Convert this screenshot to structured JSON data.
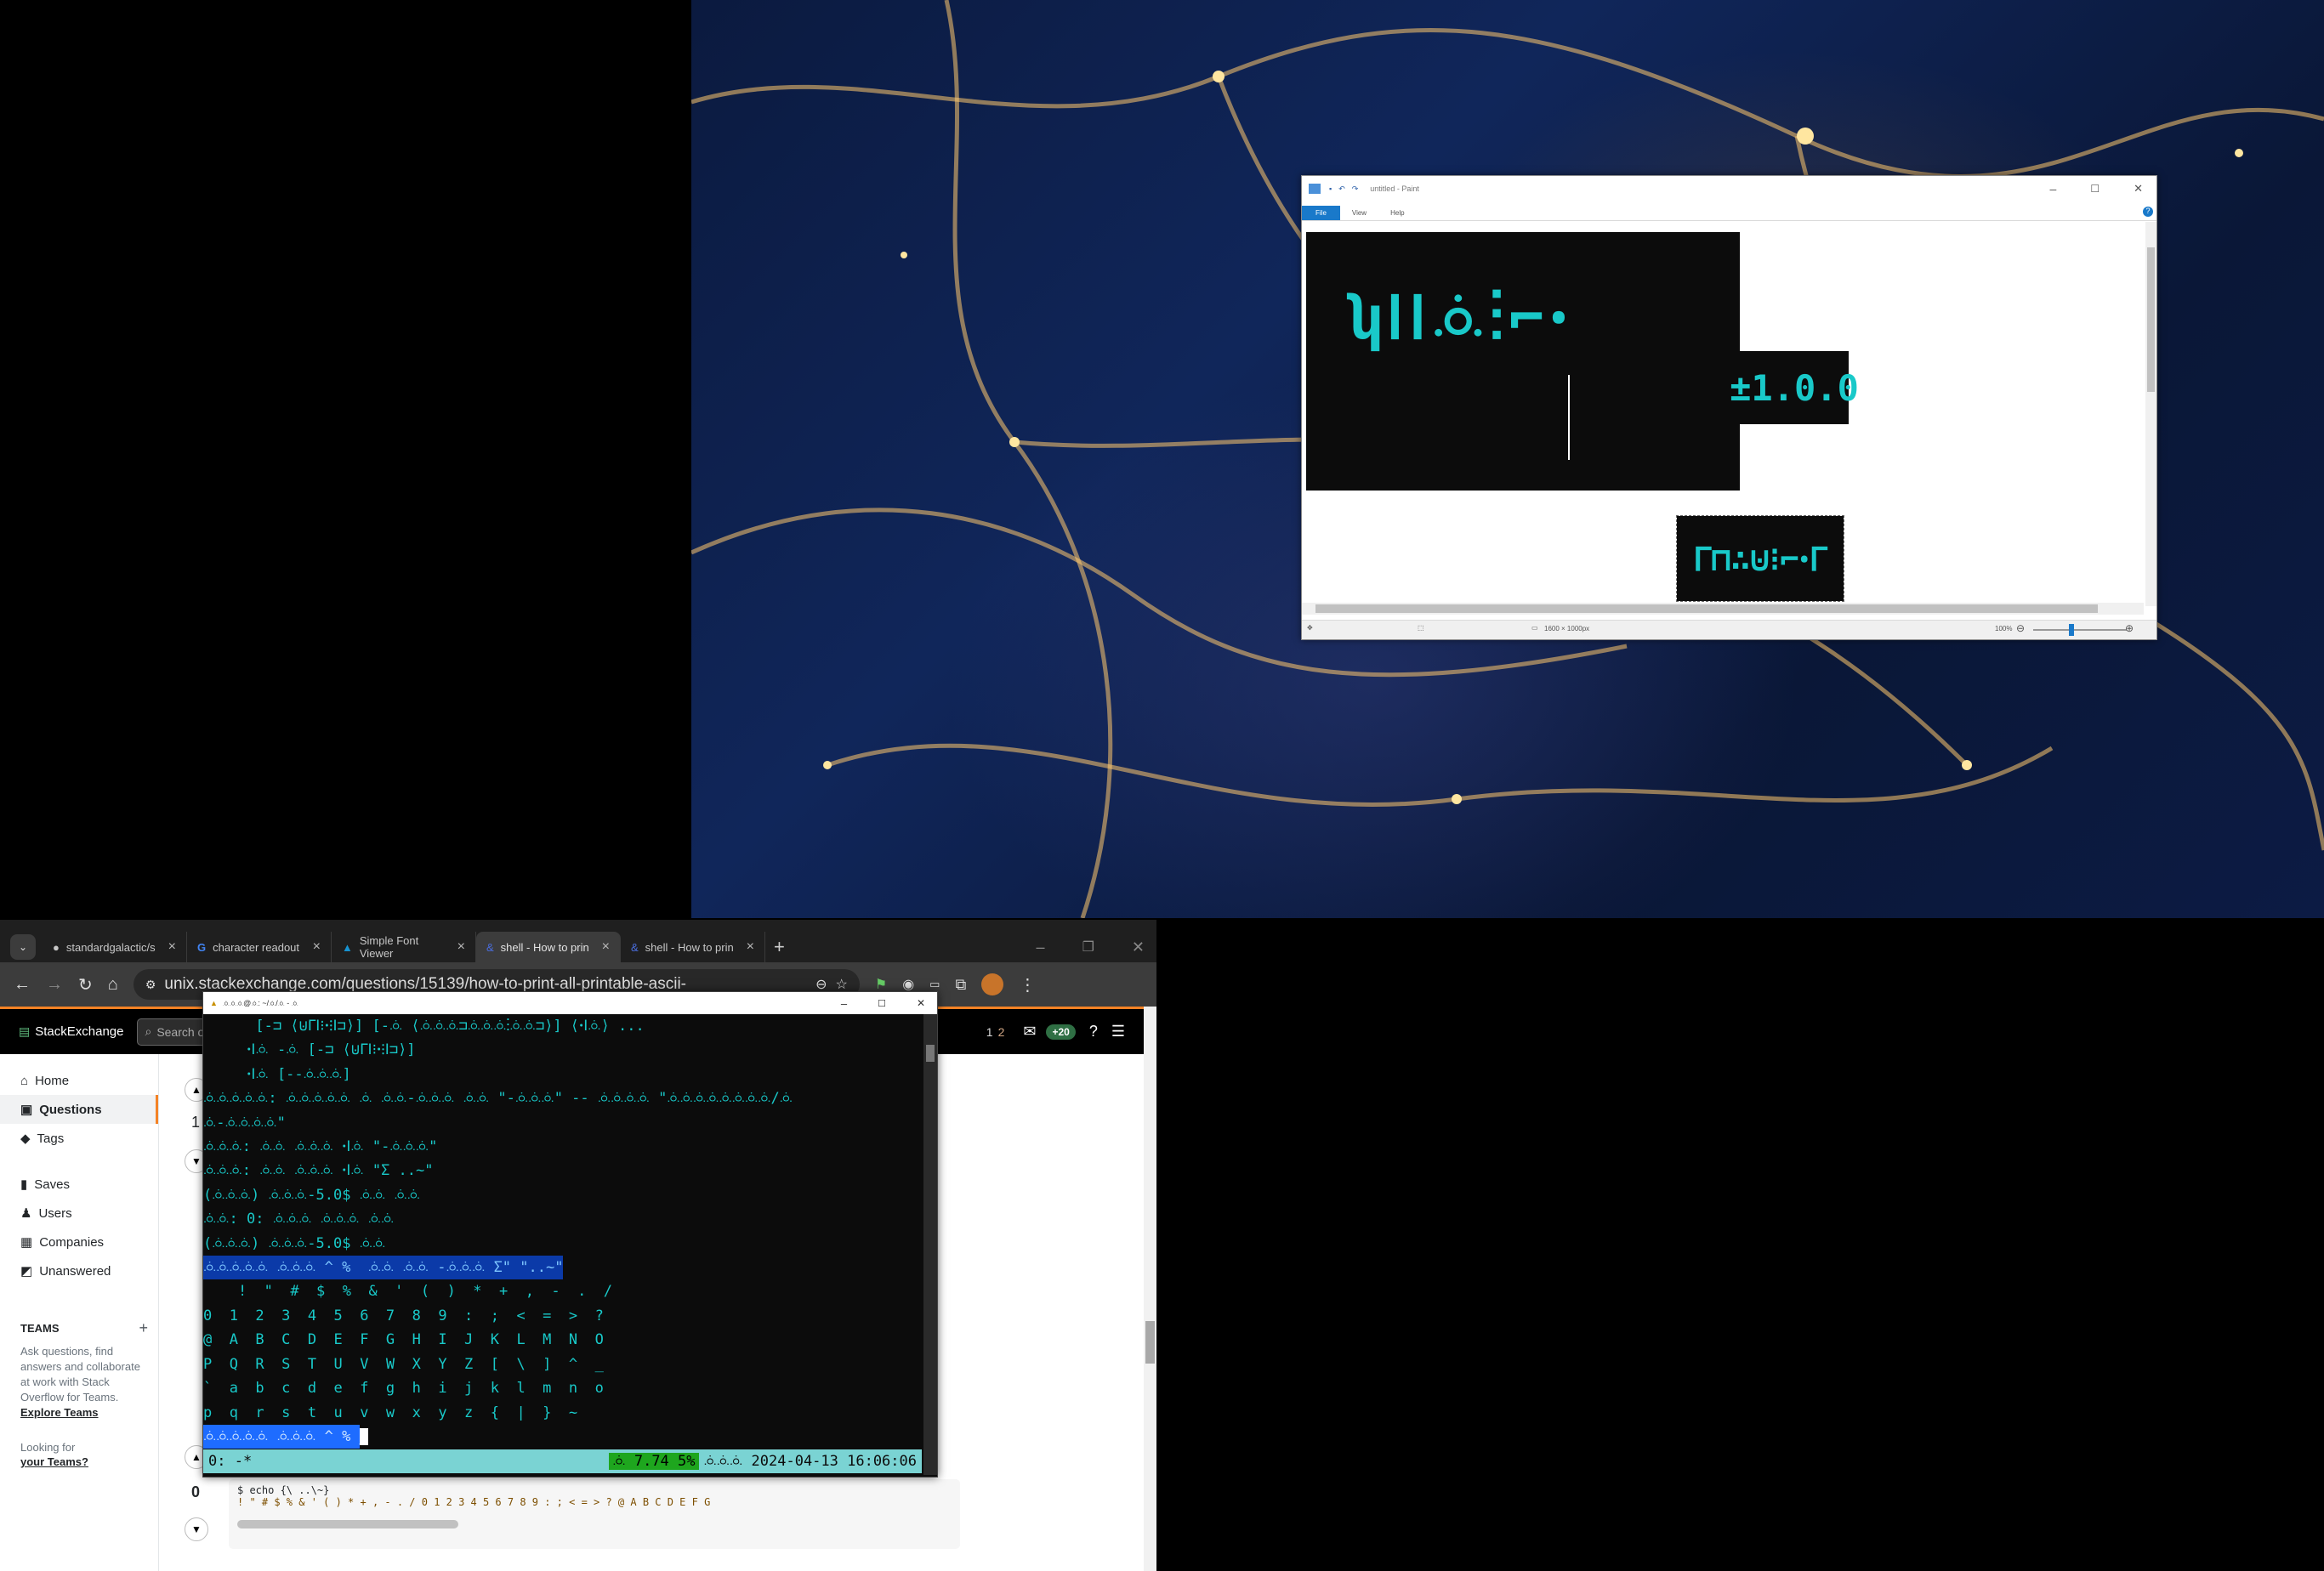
{
  "paint": {
    "title": "untitled - Paint",
    "tabs": [
      "File",
      "View",
      "Help"
    ],
    "canvas_text_1": "ʮⵏⵏꗝ⁝⌐ꞏ",
    "canvas_text_version": "±1.0.0",
    "canvas_text_2": "ᒥ⊓∴⊍⁝⌐ꞏᒥ",
    "status_size": "1600 × 1000px",
    "zoom": "100%"
  },
  "browser": {
    "tabs": [
      {
        "label": "standardgalactic/s",
        "icon": "github-icon"
      },
      {
        "label": "character readout",
        "icon": "google-icon"
      },
      {
        "label": "Simple Font Viewer",
        "icon": "arch-icon"
      },
      {
        "label": "shell - How to prin",
        "icon": "unix-icon"
      },
      {
        "label": "shell - How to prin",
        "icon": "unix-icon"
      }
    ],
    "url": "unix.stackexchange.com/questions/15139/how-to-print-all-printable-ascii-",
    "profile_badge": "+20"
  },
  "stackexchange": {
    "brand": "StackExchange",
    "search_placeholder": "Search o",
    "rep": "1",
    "bronze": "2",
    "nav": [
      "Home",
      "Questions",
      "Tags",
      "Saves",
      "Users",
      "Companies",
      "Unanswered"
    ],
    "teams_heading": "TEAMS",
    "teams_text": "Ask questions, find answers and collaborate at work with Stack Overflow for Teams.",
    "teams_link": "Explore Teams",
    "looking_for": "Looking for",
    "your_teams": "your Teams?",
    "vote_count_1": "1",
    "vote_count_2": "0",
    "code_cmd": "$ echo {\\ ..\\~}",
    "code_output": "! \" # $ % & ' ( ) * + , - . / 0 1 2 3 4 5 6 7 8 9 : ; < = > ? @ A B C D E F G"
  },
  "terminal": {
    "title": "ꗝꗝꗝ@ꗝ: ~/ꗝ/ꗝ - ꗝ",
    "lines": [
      "      [-⊐ ⟨⊍ᒥⵏ⁝ꞏ⁝ⵏ⊐⟩] [-ꗝ ⟨ꗝꗝꗝ⊐ꗝꗝꗝ⁝ꗝꗝ⊐⟩] ⟨ꞏⵏꗝ⟩ ...",
      "     ꞏⵏꗝ -ꗝ [-⊐ ⟨⊍ᒥⵏ⁝ꞏ⁝ⵏ⊐⟩]",
      "     ꞏⵏꗝ [--ꗝꗝꗝ]",
      "ꗝꗝꗝꗝꗝ: ꗝꗝꗝꗝꗝ ꗝ ꗝꗝ-ꗝꗝꗝ ꗝꗝ \"-ꗝꗝꗝ\" -- ꗝꗝꗝꗝ \"ꗝꗝꗝꗝꗝꗝꗝꗝ/ꗝ",
      "ꗝ-ꗝꗝꗝꗝ\"",
      "ꗝꗝꗝ: ꗝꗝ ꗝꗝꗝ ꞏⵏꗝ \"-ꗝꗝꗝ\"",
      "ꗝꗝꗝ: ꗝꗝ ꗝꗝꗝ ꞏⵏꗝ \"Σ ..~\"",
      "(ꗝꗝꗝ) ꗝꗝꗝ-5.0$ ꗝꗝ ꗝꗝ",
      "ꗝꗝ: 0: ꗝꗝꗝ ꗝꗝꗝ ꗝꗝ",
      "(ꗝꗝꗝ) ꗝꗝꗝ-5.0$ ꗝꗝ",
      "ꗝꗝꗝꗝꗝ ꗝꗝꗝ ^ %  ꗝꗝ ꗝꗝ -ꗝꗝꗝ Σ\" \"..~\"",
      "    !  \"  #  $  %  &  '  (  )  *  +  ,  -  .  /",
      "0  1  2  3  4  5  6  7  8  9  :  ;  <  =  >  ?",
      "@  A  B  C  D  E  F  G  H  I  J  K  L  M  N  O",
      "P  Q  R  S  T  U  V  W  X  Y  Z  [  \\  ]  ^  _",
      "`  a  b  c  d  e  f  g  h  i  j  k  l  m  n  o",
      "p  q  r  s  t  u  v  w  x  y  z  {  |  }  ~",
      "ꗝꗝꗝꗝꗝ ꗝꗝꗝ ^ % "
    ],
    "modeline_left": "0: -*",
    "modeline_mid": "ꗝ 7.74 5%",
    "modeline_right": "ꗝꗝꗝ 2024-04-13 16:06:06"
  }
}
